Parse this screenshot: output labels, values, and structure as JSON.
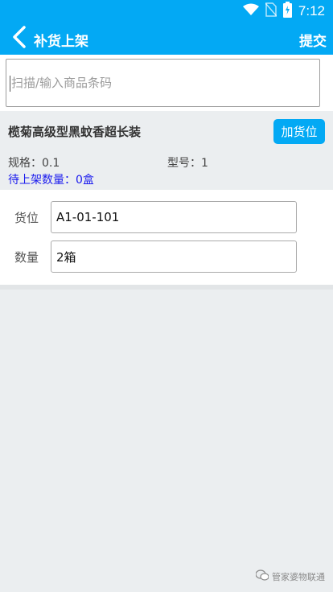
{
  "status_bar": {
    "time": "7:12",
    "icons": [
      "wifi-icon",
      "no-sim-icon",
      "battery-charging-icon"
    ]
  },
  "header": {
    "back_icon": "chevron-left-icon",
    "title": "补货上架",
    "submit_label": "提交"
  },
  "search": {
    "placeholder": "扫描/输入商品条码",
    "value": ""
  },
  "product": {
    "name": "榄菊高级型黑蚊香超长装",
    "add_location_label": "加货位",
    "spec": "规格：0.1",
    "model": "型号：1",
    "pending_qty": "待上架数量：0盒"
  },
  "form": {
    "location_label": "货位",
    "location_value": "A1-01-101",
    "quantity_label": "数量",
    "quantity_value": "2箱"
  },
  "watermark": {
    "text": "管家婆物联通",
    "icon": "wechat-icon"
  },
  "colors": {
    "accent": "#03a9f4",
    "pending_text": "#1a1aee",
    "background": "#ebeef0"
  }
}
